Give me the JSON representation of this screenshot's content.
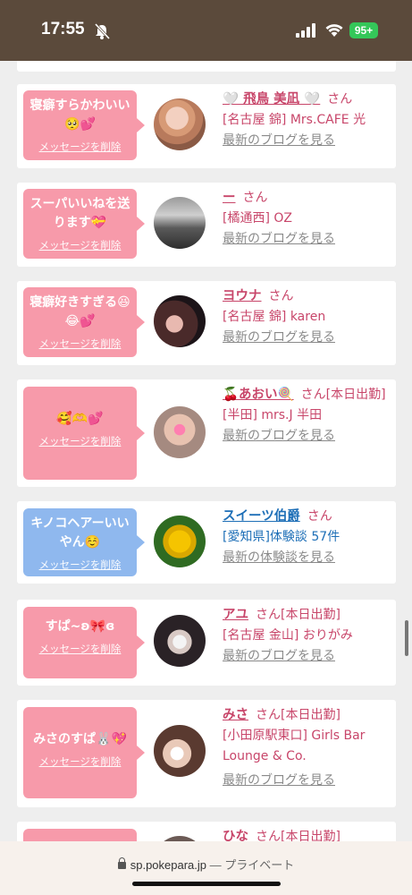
{
  "status_bar": {
    "time": "17:55",
    "battery": "95+"
  },
  "delete_label": "メッセージを削除",
  "cards": [
    {
      "message": "寝癖すらかわいい🥺💕",
      "name": "🤍 飛鳥 美凪 🤍",
      "san": "さん",
      "shop": "[名古屋 錦] Mrs.CAFE 光",
      "link": "最新のブログを見る",
      "type": "pink"
    },
    {
      "message": "スーパいいねを送ります💝",
      "name": "ー",
      "san": "さん",
      "shop": "[橘通西] OZ",
      "link": "最新のブログを見る",
      "type": "pink"
    },
    {
      "message": "寝癖好きすぎる😆😂💕",
      "name": "ヨウナ",
      "san": "さん",
      "shop": "[名古屋 錦] karen",
      "link": "最新のブログを見る",
      "type": "pink"
    },
    {
      "message": "🥰🫶💕",
      "name": "🍒あおい🍭",
      "san": "さん[本日出勤]",
      "shop": "[半田] mrs.J 半田",
      "link": "最新のブログを見る",
      "type": "pink"
    },
    {
      "message": "キノコヘアーいいやん☺️",
      "name": "スイーツ伯爵",
      "san": "さん",
      "shop": "[愛知県]体験談 57件",
      "link": "最新の体験談を見る",
      "type": "blue"
    },
    {
      "message": "すぱ~ʚ🎀ɞ",
      "name": "アユ",
      "san": "さん[本日出勤]",
      "shop": "[名古屋 金山] おりがみ",
      "link": "最新のブログを見る",
      "type": "pink"
    },
    {
      "message": "みさのすぱ🐰💖",
      "name": "みさ",
      "san": "さん[本日出勤]",
      "shop": "[小田原駅東口] Girls Bar Lounge & Co.",
      "link": "最新のブログを見る",
      "type": "pink"
    },
    {
      "name": "ひな",
      "san": "さん[本日出勤]",
      "type": "pink"
    }
  ],
  "browser": {
    "url": "sp.pokepara.jp",
    "mode": "— プライベート"
  }
}
